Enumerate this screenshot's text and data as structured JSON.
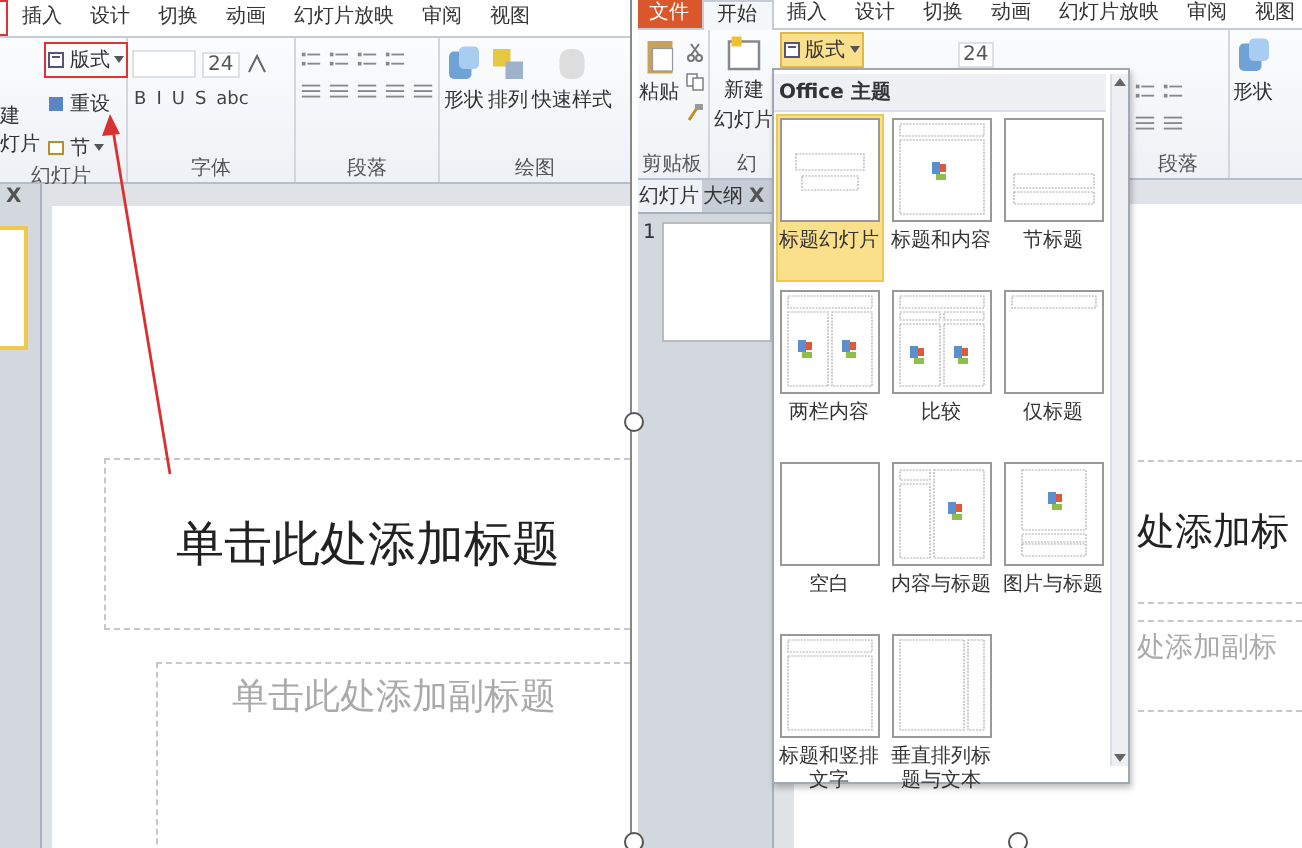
{
  "left_window": {
    "tabs": [
      {
        "label": "插入",
        "selected": false
      },
      {
        "label": "设计",
        "selected": false
      },
      {
        "label": "切换",
        "selected": false
      },
      {
        "label": "动画",
        "selected": false
      },
      {
        "label": "幻灯片放映",
        "selected": false
      },
      {
        "label": "审阅",
        "selected": false
      },
      {
        "label": "视图",
        "selected": false
      }
    ],
    "new_slide_partial": [
      "建",
      "灯片"
    ],
    "layout_button": {
      "label": "版式",
      "highlighted": true
    },
    "reset_button": "重设",
    "section_button": "节",
    "font_size": "24",
    "format_buttons": [
      "B",
      "I",
      "U",
      "S",
      "abc"
    ],
    "drawing_buttons": [
      "形状",
      "排列",
      "快速样式"
    ],
    "groups": [
      "幻灯片",
      "字体",
      "段落",
      "绘图"
    ],
    "close_pane": "X",
    "slide": {
      "title": "单击此处添加标题",
      "subtitle": "单击此处添加副标题"
    }
  },
  "right_window": {
    "tabs": [
      {
        "label": "文件",
        "kind": "file",
        "selected": false
      },
      {
        "label": "开始",
        "kind": "tab",
        "selected": true
      },
      {
        "label": "插入",
        "kind": "tab",
        "selected": false
      },
      {
        "label": "设计",
        "kind": "tab",
        "selected": false
      },
      {
        "label": "切换",
        "kind": "tab",
        "selected": false
      },
      {
        "label": "动画",
        "kind": "tab",
        "selected": false
      },
      {
        "label": "幻灯片放映",
        "kind": "tab",
        "selected": false
      },
      {
        "label": "审阅",
        "kind": "tab",
        "selected": false
      },
      {
        "label": "视图",
        "kind": "tab",
        "selected": false
      }
    ],
    "paste_button": "粘贴",
    "new_slide_button": [
      "新建",
      "幻灯片"
    ],
    "layout_button": {
      "label": "版式",
      "pressed": true
    },
    "font_size": "24",
    "shape_button": "形状",
    "groups": [
      "剪贴板",
      "幻",
      "段落"
    ],
    "pane_tabs": [
      {
        "label": "幻灯片",
        "selected": true
      },
      {
        "label": "大纲",
        "selected": false
      }
    ],
    "close_pane": "X",
    "slide_number": "1",
    "slide": {
      "title": "处添加标",
      "subtitle": "处添加副标"
    },
    "layout_gallery": {
      "title": "Office 主题",
      "items": [
        {
          "label": "标题幻灯片",
          "kind": "title",
          "selected": true
        },
        {
          "label": "标题和内容",
          "kind": "title_content",
          "selected": false
        },
        {
          "label": "节标题",
          "kind": "section",
          "selected": false
        },
        {
          "label": "两栏内容",
          "kind": "two_content",
          "selected": false
        },
        {
          "label": "比较",
          "kind": "comparison",
          "selected": false
        },
        {
          "label": "仅标题",
          "kind": "title_only",
          "selected": false
        },
        {
          "label": "空白",
          "kind": "blank",
          "selected": false
        },
        {
          "label": "内容与标题",
          "kind": "content_caption",
          "selected": false
        },
        {
          "label": "图片与标题",
          "kind": "picture_caption",
          "selected": false
        },
        {
          "label": "标题和竖排文字",
          "kind": "vertical_text",
          "selected": false
        },
        {
          "label": "垂直排列标题与文本",
          "kind": "vertical_title",
          "selected": false
        }
      ]
    }
  }
}
